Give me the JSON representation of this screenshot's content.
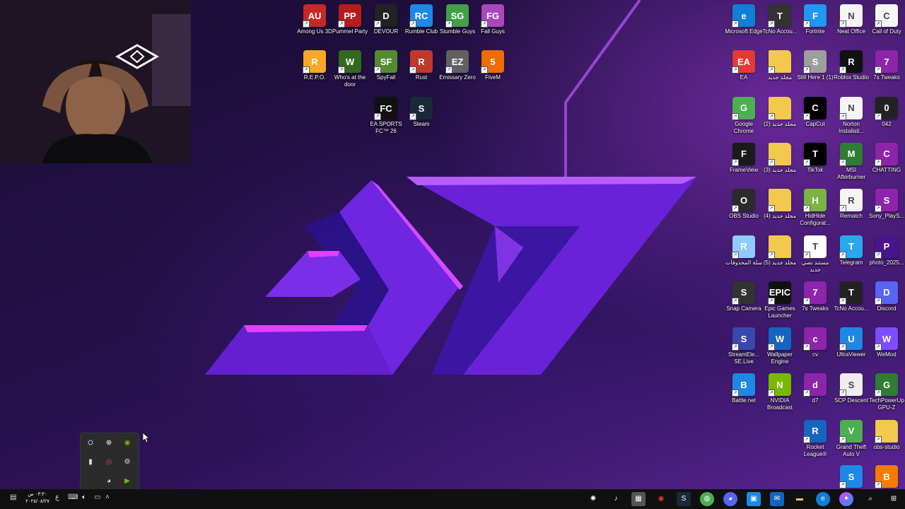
{
  "desktop": {
    "icons_center": [
      {
        "label": "Among Us 3D",
        "icon": "among-us-icon",
        "color": "#c62828",
        "text": "AU"
      },
      {
        "label": "Pummel Party",
        "icon": "pummel-party-icon",
        "color": "#b71c1c",
        "text": "PP"
      },
      {
        "label": "DEVOUR",
        "icon": "devour-icon",
        "color": "#222222",
        "text": "D"
      },
      {
        "label": "Rumble Club",
        "icon": "rumble-club-icon",
        "color": "#1e88e5",
        "text": "RC"
      },
      {
        "label": "Stumble Guys",
        "icon": "stumble-guys-icon",
        "color": "#43a047",
        "text": "SG"
      },
      {
        "label": "Fall Guys",
        "icon": "fall-guys-icon",
        "color": "#ab47bc",
        "text": "FG"
      },
      {
        "label": "R.E.P.O.",
        "icon": "repo-icon",
        "color": "#f9a825",
        "text": "R"
      },
      {
        "label": "Who's at the door",
        "icon": "whos-at-the-door-icon",
        "color": "#33691e",
        "text": "W"
      },
      {
        "label": "SpyFall",
        "icon": "spyfall-icon",
        "color": "#558b2f",
        "text": "SF"
      },
      {
        "label": "Rust",
        "icon": "rust-icon",
        "color": "#c0392b",
        "text": "R"
      },
      {
        "label": "Emissary Zero",
        "icon": "emissary-zero-icon",
        "color": "#616161",
        "text": "EZ"
      },
      {
        "label": "FiveM",
        "icon": "fivem-icon",
        "color": "#ef6c00",
        "text": "5"
      },
      {
        "label": "EA SPORTS FC™ 26",
        "icon": "ea-sports-fc-icon",
        "color": "#111111",
        "text": "FC"
      },
      {
        "label": "Steam",
        "icon": "steam-icon",
        "color": "#1b2838",
        "text": "S"
      }
    ],
    "icons_right": [
      [
        "Microsoft Edge",
        "edge-icon",
        "#0f7fd8",
        "e"
      ],
      [
        "TcNo Accou...",
        "tcno-icon",
        "#333333",
        "T"
      ],
      [
        "Fortnite",
        "fortnite-icon",
        "#2196f3",
        "F"
      ],
      [
        "Neat Office",
        "neat-office-icon",
        "#f5f5f5",
        "N"
      ],
      [
        "Call of Duty",
        "call-of-duty-icon",
        "#f5f5f5",
        "C"
      ],
      [
        "EA",
        "ea-icon",
        "#e53935",
        "EA"
      ],
      [
        "مجلد جديد",
        "folder-icon",
        "#f2c94c",
        ""
      ],
      [
        "Still Here 1 (1)",
        "still-here-icon",
        "#9e9e9e",
        "S"
      ],
      [
        "Roblox Studio",
        "roblox-studio-icon",
        "#111111",
        "R"
      ],
      [
        "7s Tweaks",
        "winrar-icon",
        "#8e24aa",
        "7"
      ],
      [
        "Google Chrome",
        "chrome-icon",
        "#4caf50",
        "G"
      ],
      [
        "مجلد جديد (2)",
        "folder-icon",
        "#f2c94c",
        ""
      ],
      [
        "CapCut",
        "capcut-icon",
        "#000000",
        "C"
      ],
      [
        "Norton Installati...",
        "norton-icon",
        "#f5f5f5",
        "N"
      ],
      [
        "042",
        "file-icon",
        "#222222",
        "0"
      ],
      [
        "FrameView",
        "frameview-icon",
        "#1a1a1a",
        "F"
      ],
      [
        "مجلد جديد (3)",
        "folder-icon",
        "#f2c94c",
        ""
      ],
      [
        "TikTok",
        "tiktok-icon",
        "#000000",
        "T"
      ],
      [
        "MSI Afterburner",
        "msi-afterburner-icon",
        "#2e7d32",
        "M"
      ],
      [
        "CHATTING",
        "winrar-icon",
        "#8e24aa",
        "C"
      ],
      [
        "OBS Studio",
        "obs-icon",
        "#2b2b2b",
        "O"
      ],
      [
        "مجلد جديد (4)",
        "folder-icon",
        "#f2c94c",
        ""
      ],
      [
        "HidHide Configurat...",
        "hidhide-icon",
        "#7cb342",
        "H"
      ],
      [
        "Rematch",
        "file-icon",
        "#f5f5f5",
        "R"
      ],
      [
        "Sony_PlayS...",
        "winrar-icon",
        "#8e24aa",
        "S"
      ],
      [
        "سلة المحذوفات",
        "recycle-bin-icon",
        "#90caf9",
        "R"
      ],
      [
        "مجلد جديد (5)",
        "folder-icon",
        "#f2c94c",
        ""
      ],
      [
        "مستند نصي جديد",
        "text-document-icon",
        "#ffffff",
        "T"
      ],
      [
        "Telegram",
        "telegram-icon",
        "#29a9eb",
        "T"
      ],
      [
        "photo_2025...",
        "image-icon",
        "#4a148c",
        "P"
      ],
      [
        "Snap Camera",
        "snap-camera-icon",
        "#333333",
        "S"
      ],
      [
        "Epic Games Launcher",
        "epic-games-icon",
        "#111111",
        "EPIC"
      ],
      [
        "7s Tweaks",
        "winrar-icon",
        "#8e24aa",
        "7"
      ],
      [
        "TcNo Accou...",
        "tcno-icon",
        "#222222",
        "T"
      ],
      [
        "Discord",
        "discord-icon",
        "#5865f2",
        "D"
      ],
      [
        "StreamEle... SE.Live",
        "streamelements-icon",
        "#3949ab",
        "S"
      ],
      [
        "Wallpaper Engine",
        "wallpaper-engine-icon",
        "#1565c0",
        "W"
      ],
      [
        "cv",
        "winrar-icon",
        "#8e24aa",
        "c"
      ],
      [
        "UltraViewer",
        "ultraviewer-icon",
        "#1e88e5",
        "U"
      ],
      [
        "WeMod",
        "wemod-icon",
        "#7c4dff",
        "W"
      ],
      [
        "Battle.net",
        "battlenet-icon",
        "#1e88e5",
        "B"
      ],
      [
        "NVIDIA Broadcast",
        "nvidia-broadcast-icon",
        "#76b900",
        "N"
      ],
      [
        "d7",
        "winrar-icon",
        "#8e24aa",
        "d"
      ],
      [
        "SCP Descent",
        "scp-descent-icon",
        "#eeeeee",
        "S"
      ],
      [
        "TechPowerUp GPU-Z",
        "gpu-z-icon",
        "#2e7d32",
        "G"
      ],
      [
        "",
        "",
        "",
        " "
      ],
      [
        "",
        "",
        "",
        " "
      ],
      [
        "Rocket League®",
        "rocket-league-icon",
        "#1565c0",
        "R"
      ],
      [
        "Grand Theft Auto V",
        "gta-v-icon",
        "#4caf50",
        "V"
      ],
      [
        "obs-studio",
        "folder-icon",
        "#f2c94c",
        ""
      ]
    ],
    "icons_bottom_right": [
      [
        "",
        "pinned-app-icon",
        "#1e88e5",
        "S"
      ],
      [
        "",
        "blender-icon",
        "#f57c00",
        "B"
      ]
    ]
  },
  "tray_popup": {
    "icons": [
      "steam-tray-icon",
      "xbox-tray-icon",
      "nvidia-tray-icon",
      "microphone-tray-icon",
      "recording-tray-icon",
      "settings-tray-icon",
      "discord-tray-icon",
      "play-tray-icon"
    ]
  },
  "taskbar": {
    "clock_time": "٠٣:٣٠ ص",
    "clock_date": "٢٠٢٥/٠٨/٢٧",
    "lang": "ع"
  }
}
